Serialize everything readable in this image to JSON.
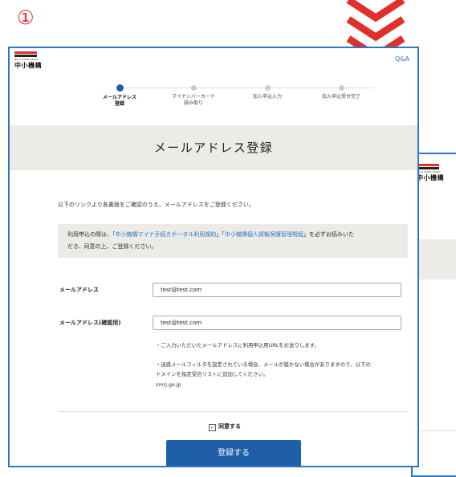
{
  "step_number": "①",
  "header": {
    "logo_tagline": "Be a Great Small",
    "logo_name": "中小機構",
    "qa_link": "Q&A"
  },
  "stepper": [
    {
      "label": "メールアドレス\n登録",
      "active": true
    },
    {
      "label": "マイナンバーカード\n読み取り",
      "active": false
    },
    {
      "label": "加入申込入力",
      "active": false
    },
    {
      "label": "加入申込受付完了",
      "active": false
    }
  ],
  "page_title": "メールアドレス登録",
  "intro": "以下のリンクより各書面をご確認のうえ、メールアドレスをご登録ください。",
  "notice": {
    "prefix": "利用申込の際は、「",
    "link1": "中小機構マイナ手続きポータル利用規約",
    "mid": "」「",
    "link2": "中小機構個人情報保護管理規程",
    "suffix": "」を必ずお読みいた",
    "line2": "だき、同意の上、ご登録ください。"
  },
  "form": {
    "email_label": "メールアドレス",
    "email_value": "test@test.com",
    "confirm_label": "メールアドレス(確認用)",
    "confirm_value": "test@test.com"
  },
  "notes": {
    "note1": "・ご入力いただいたメールアドレスに利用申込用URLをお送りします。",
    "note2_line1": "・迷惑メールフィルタを設定されている場合、メールが届かない場合がありますので、以下の",
    "note2_line2": "ドメインを指定受信リストに追加してください。",
    "domain": "smrj.go.jp"
  },
  "agree_label": "同意する",
  "submit_label": "登録する",
  "colors": {
    "accent": "#e0302a",
    "primary": "#1f5fa8",
    "frame": "#2c76c8",
    "band": "#ecebe7"
  }
}
